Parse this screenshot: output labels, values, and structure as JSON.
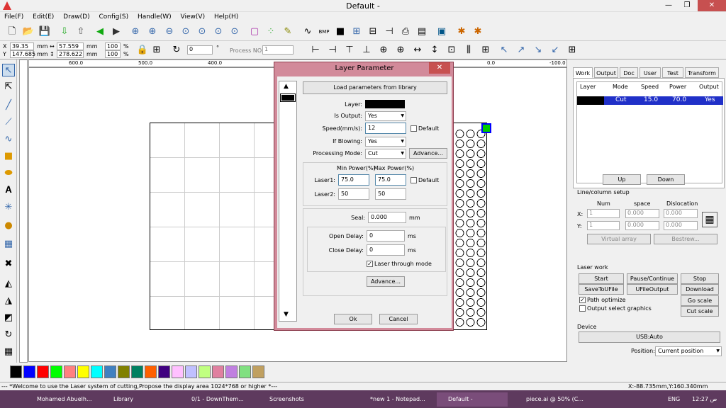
{
  "window": {
    "title": "Default -",
    "min": "—",
    "max": "❐",
    "close": "✕"
  },
  "menu": [
    "File(F)",
    "Edit(E)",
    "Draw(D)",
    "Config(S)",
    "Handle(W)",
    "View(V)",
    "Help(H)"
  ],
  "coords": {
    "x_label": "X",
    "y_label": "Y",
    "x_val": "39.35",
    "y_val": "147.685",
    "unit1": "mm",
    "unit2": "mm",
    "w_val": "57.559",
    "h_val": "278.622",
    "unit3": "mm",
    "unit4": "mm",
    "sx": "100",
    "sy": "100",
    "pct1": "%",
    "pct2": "%",
    "rot": "0",
    "deg": "°",
    "process_label": "Process NO:",
    "process_val": "1"
  },
  "ruler": {
    "t1": "600.0",
    "t2": "500.0",
    "t3": "400.0",
    "t4": "0.0",
    "t5": "-100.0"
  },
  "palette": [
    "#000000",
    "#0000ff",
    "#ff0000",
    "#00ff00",
    "#ff8080",
    "#ffff00",
    "#00ffff",
    "#4080c0",
    "#808000",
    "#008060",
    "#ff6000",
    "#400080",
    "#ffc0ff",
    "#c0c0ff",
    "#c0ff80",
    "#e080a0",
    "#c080e0",
    "#80e080",
    "#c0a060"
  ],
  "status": {
    "msg": "--- *Welcome to use the Laser system of cutting,Propose the display area 1024*768 or higher *---",
    "pos": "X:-88.735mm,Y:160.340mm"
  },
  "taskbar": {
    "items": [
      "Mohamed Abuelh...",
      "Library",
      "0/1 - DownThem...",
      "Screenshots",
      "",
      "*new 1 - Notepad...",
      "Default -",
      "piece.ai @ 50% (C..."
    ],
    "lang": "ENG",
    "clock": "12:27 ص"
  },
  "panel": {
    "tabs": [
      "Work",
      "Output",
      "Doc",
      "User",
      "Test",
      "Transform"
    ],
    "table": {
      "headers": [
        "Layer",
        "Mode",
        "Speed",
        "Power",
        "Output"
      ],
      "row": {
        "mode": "Cut",
        "speed": "15.0",
        "power": "70.0",
        "output": "Yes"
      }
    },
    "up": "Up",
    "down": "Down",
    "array": {
      "title": "Line/column setup",
      "num": "Num",
      "space": "space",
      "dislocation": "Dislocation",
      "x": "X:",
      "y": "Y:",
      "xn": "1",
      "yn": "1",
      "xs": "0.000",
      "ys": "0.000",
      "xd": "0.000",
      "yd": "0.000",
      "virtual": "Virtual array",
      "bestrew": "Bestrew..."
    },
    "laserwork": {
      "title": "Laser work",
      "start": "Start",
      "pause": "Pause/Continue",
      "stop": "Stop",
      "save": "SaveToUFile",
      "ufile": "UFileOutput",
      "download": "Download",
      "path": "Path optimize",
      "outsel": "Output select graphics",
      "goscale": "Go scale",
      "cutscale": "Cut scale"
    },
    "device": {
      "title": "Device",
      "usb": "USB:Auto",
      "pos_label": "Position:",
      "pos_val": "Current position"
    }
  },
  "dialog": {
    "title": "Layer Parameter",
    "load": "Load parameters from library",
    "layer": "Layer:",
    "is_output": "Is Output:",
    "is_output_val": "Yes",
    "speed": "Speed(mm/s):",
    "speed_val": "12",
    "default": "Default",
    "blowing": "If Blowing:",
    "blowing_val": "Yes",
    "mode": "Processing Mode:",
    "mode_val": "Cut",
    "advance": "Advance...",
    "minp": "Min Power(%)",
    "maxp": "Max Power(%)",
    "laser1": "Laser1:",
    "l1min": "75.0",
    "l1max": "75.0",
    "laser2": "Laser2:",
    "l2min": "50",
    "l2max": "50",
    "default2": "Default",
    "seal": "Seal:",
    "seal_val": "0.000",
    "mm": "mm",
    "open": "Open Delay:",
    "open_val": "0",
    "close": "Close Delay:",
    "close_val": "0",
    "ms1": "ms",
    "ms2": "ms",
    "through": "Laser through mode",
    "advance2": "Advance...",
    "ok": "Ok",
    "cancel": "Cancel"
  }
}
